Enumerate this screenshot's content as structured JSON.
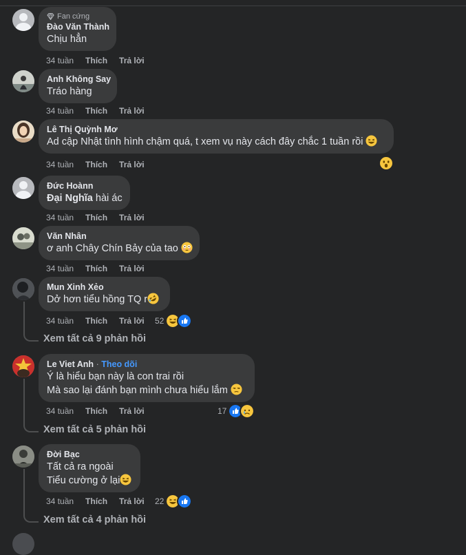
{
  "comments": [
    {
      "badge": "Fan cứng",
      "name": "Đào Văn Thành",
      "text": "Chịu hẳn",
      "time": "34 tuần",
      "like": "Thích",
      "reply": "Trả lời"
    },
    {
      "name": "Anh Không Say",
      "text": "Tráo hàng",
      "time": "34 tuần",
      "like": "Thích",
      "reply": "Trả lời"
    },
    {
      "name": "Lê Thị Quỳnh Mơ",
      "text": "Ad cập Nhật tình hình chậm quá, t xem vụ này cách đây chắc 1 tuần rồi",
      "time": "34 tuần",
      "like": "Thích",
      "reply": "Trả lời"
    },
    {
      "name": "Đức Hoànn",
      "text_bold": "Đại Nghĩa",
      "text": "hài ác",
      "time": "34 tuần",
      "like": "Thích",
      "reply": "Trả lời"
    },
    {
      "name": "Văn Nhân",
      "text": "ơ anh Chây Chín Bảy của tao",
      "time": "34 tuần",
      "like": "Thích",
      "reply": "Trả lời"
    },
    {
      "name": "Mun Xinh Xẻo",
      "text": "Dở hơn tiểu hồng TQ r",
      "time": "34 tuần",
      "like": "Thích",
      "reply": "Trả lời",
      "reaction_count": "52",
      "view_replies": "Xem tất cả 9 phản hồi"
    },
    {
      "name": "Le Viet Anh",
      "separator": "·",
      "follow": "Theo dõi",
      "text": "Ý là hiểu bạn này là con trai rồi",
      "text2": "Mà sao lại đánh bạn mình chưa hiểu lắm",
      "time": "34 tuần",
      "like": "Thích",
      "reply": "Trả lời",
      "reaction_count": "17",
      "view_replies": "Xem tất cả 5 phản hồi"
    },
    {
      "name": "Đời Bạc",
      "text": "Tất cả ra ngoài",
      "text2": "Tiểu cường ở lại",
      "time": "34 tuần",
      "like": "Thích",
      "reply": "Trả lời",
      "reaction_count": "22",
      "view_replies": "Xem tất cả 4 phản hồi"
    }
  ],
  "icons": {
    "badge": "diamond-icon",
    "laugh": "laughing-emoji",
    "wow": "wow-reaction",
    "flushed": "flushed-emoji",
    "rofl": "rolling-laughing-emoji",
    "like": "like-reaction",
    "sad": "sad-reaction",
    "unamused": "unamused-emoji"
  },
  "colors": {
    "background": "#242526",
    "bubble": "#3a3b3c",
    "primary_text": "#e4e6eb",
    "secondary_text": "#b0b3b8",
    "link": "#4599ff"
  }
}
